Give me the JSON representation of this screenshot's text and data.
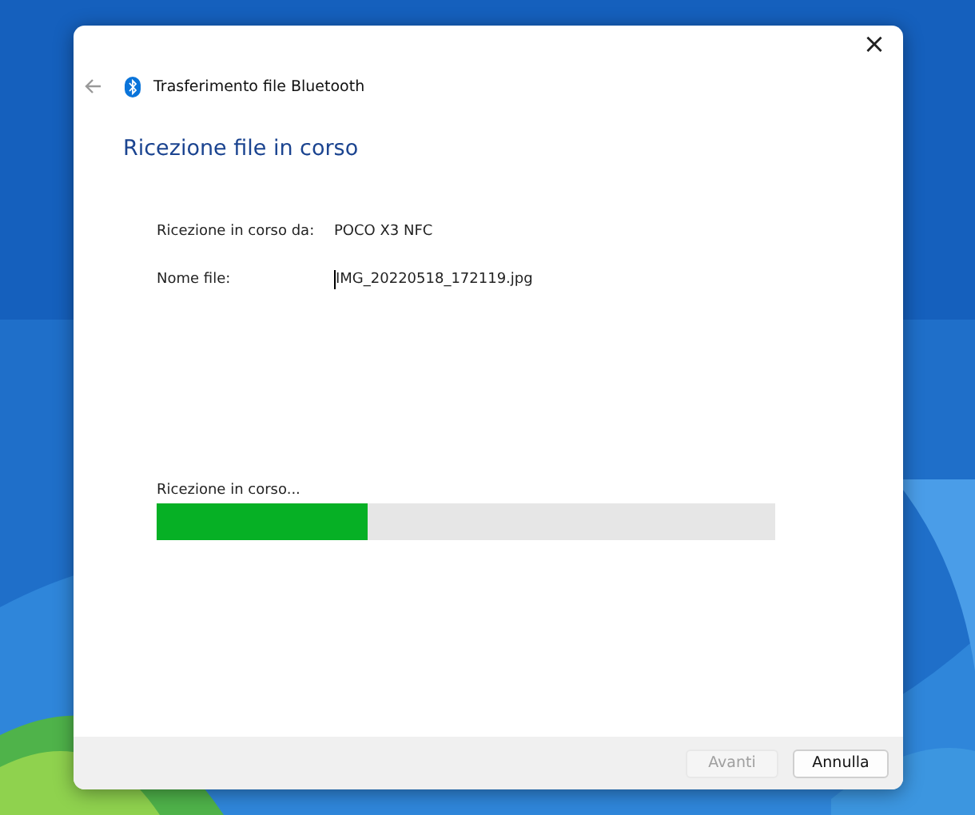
{
  "window": {
    "title": "Trasferimento file Bluetooth",
    "close": "×"
  },
  "heading": "Ricezione file in corso",
  "fields": [
    {
      "label": "Ricezione in corso da:",
      "value": "POCO X3 NFC",
      "cursor": false
    },
    {
      "label": "Nome file:",
      "value": "IMG_20220518_172119.jpg",
      "cursor": true
    }
  ],
  "progress": {
    "label": "Ricezione in corso...",
    "level": 0.34
  },
  "buttons": [
    {
      "label": "Avanti",
      "disabled": true
    },
    {
      "label": "Annulla",
      "disabled": false
    }
  ]
}
